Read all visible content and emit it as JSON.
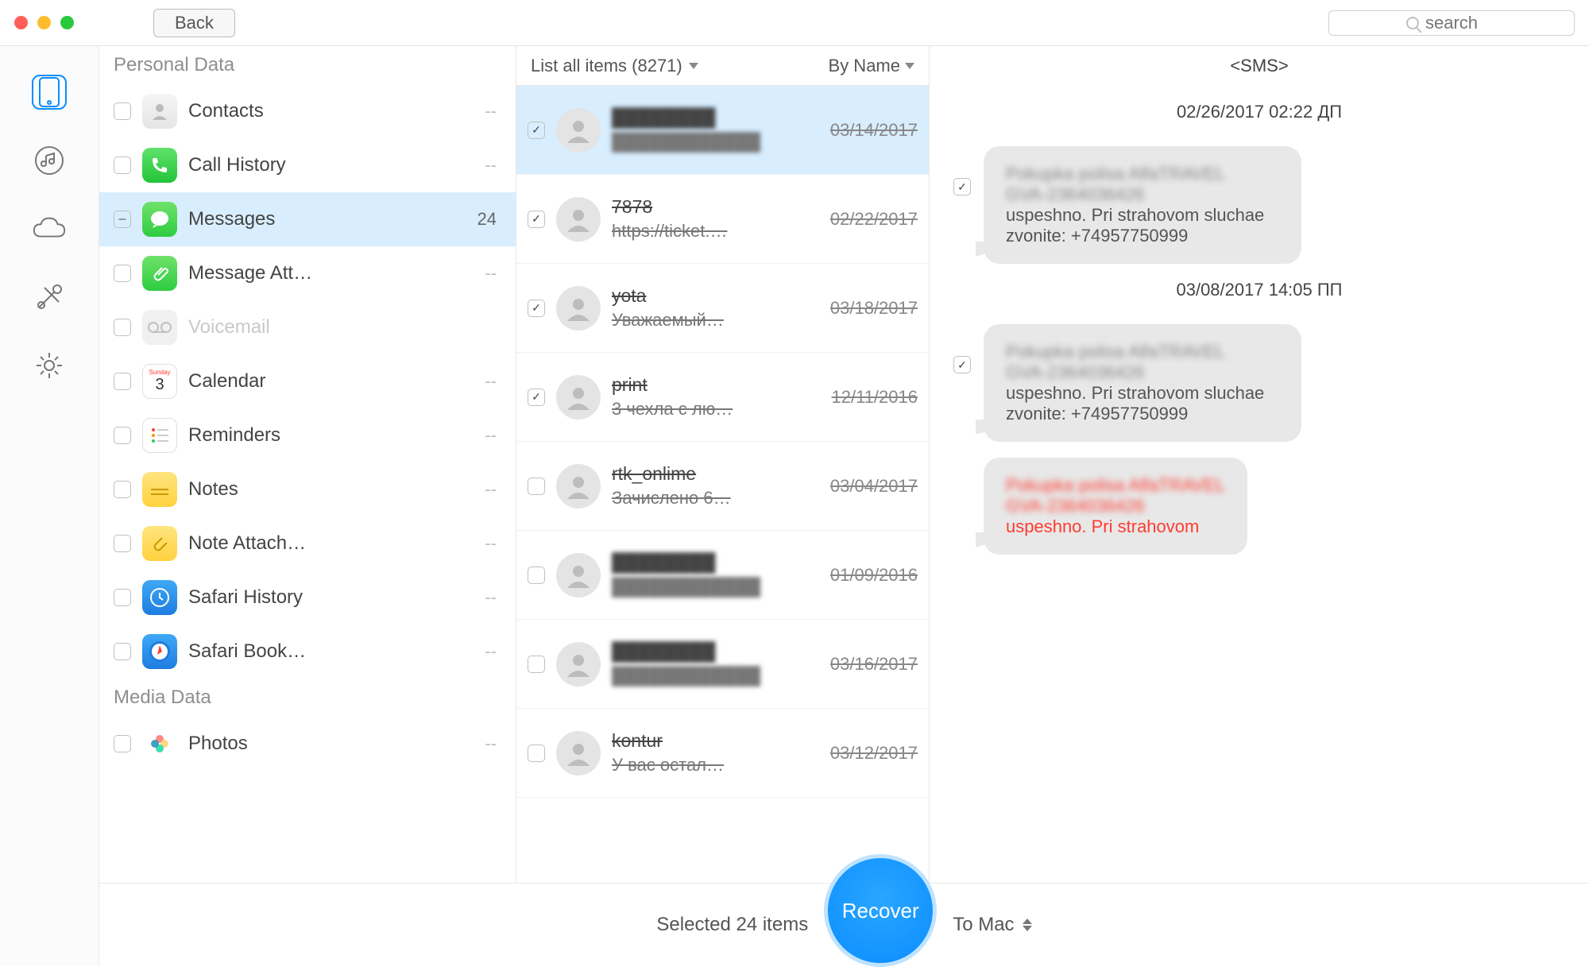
{
  "titlebar": {
    "back_label": "Back",
    "search_placeholder": "search"
  },
  "iconbar": {
    "items": [
      "device",
      "media",
      "cloud",
      "tools",
      "settings"
    ]
  },
  "categories": {
    "personal_header": "Personal Data",
    "media_header": "Media Data",
    "items": [
      {
        "id": "contacts",
        "label": "Contacts",
        "count": "--",
        "checked": false
      },
      {
        "id": "call-history",
        "label": "Call History",
        "count": "--",
        "checked": false
      },
      {
        "id": "messages",
        "label": "Messages",
        "count": "24",
        "checked": "partial",
        "selected": true
      },
      {
        "id": "message-att",
        "label": "Message Att…",
        "count": "--",
        "checked": false
      },
      {
        "id": "voicemail",
        "label": "Voicemail",
        "count": "",
        "checked": false,
        "disabled": true
      },
      {
        "id": "calendar",
        "label": "Calendar",
        "count": "--",
        "checked": false
      },
      {
        "id": "reminders",
        "label": "Reminders",
        "count": "--",
        "checked": false
      },
      {
        "id": "notes",
        "label": "Notes",
        "count": "--",
        "checked": false
      },
      {
        "id": "note-attach",
        "label": "Note Attach…",
        "count": "--",
        "checked": false
      },
      {
        "id": "safari-history",
        "label": "Safari History",
        "count": "--",
        "checked": false
      },
      {
        "id": "safari-book",
        "label": "Safari Book…",
        "count": "--",
        "checked": false
      }
    ],
    "media_items": [
      {
        "id": "photos",
        "label": "Photos",
        "count": "--",
        "checked": false
      }
    ]
  },
  "msg_header": {
    "filter_label": "List all items (8271)",
    "sort_label": "By Name"
  },
  "messages": [
    {
      "title": "",
      "sub": "",
      "date": "03/14/2017",
      "checked": true,
      "selected": true,
      "blurred": true
    },
    {
      "title": "7878",
      "sub": "https://ticket.…",
      "date": "02/22/2017",
      "checked": true
    },
    {
      "title": "yota",
      "sub": "Уважаемый…",
      "date": "03/18/2017",
      "checked": true
    },
    {
      "title": "print",
      "sub": "3 чехла с лю…",
      "date": "12/11/2016",
      "checked": true
    },
    {
      "title": "rtk_onlime",
      "sub": "Зачислено 6…",
      "date": "03/04/2017",
      "checked": false
    },
    {
      "title": "",
      "sub": "",
      "date": "01/09/2016",
      "checked": false,
      "blurred": true
    },
    {
      "title": "",
      "sub": "",
      "date": "03/16/2017",
      "checked": false,
      "blurred": true
    },
    {
      "title": "kontur",
      "sub": "У вас остал…",
      "date": "03/12/2017",
      "checked": false
    }
  ],
  "detail": {
    "header": "<SMS>",
    "blocks": [
      {
        "timestamp": "02/26/2017 02:22 ДП",
        "checked": true,
        "blur1": "Pokupka polisa AlfaTRAVEL",
        "blur2": "GVA-2364036426",
        "text": "uspeshno. Pri strahovom sluchae zvonite: +74957750999"
      },
      {
        "timestamp": "03/08/2017 14:05 ПП",
        "checked": true,
        "blur1": "Pokupka polisa AlfaTRAVEL",
        "blur2": "GVA-2364036426",
        "text": "uspeshno. Pri strahovom sluchae zvonite: +74957750999"
      }
    ],
    "partial": {
      "blur1": "Pokupka polisa AlfaTRAVEL",
      "blur2": "GVA-2364036426",
      "text": "uspeshno. Pri strahovom"
    }
  },
  "bottom": {
    "selected_text": "Selected 24 items",
    "recover_label": "Recover",
    "destination": "To Mac"
  }
}
